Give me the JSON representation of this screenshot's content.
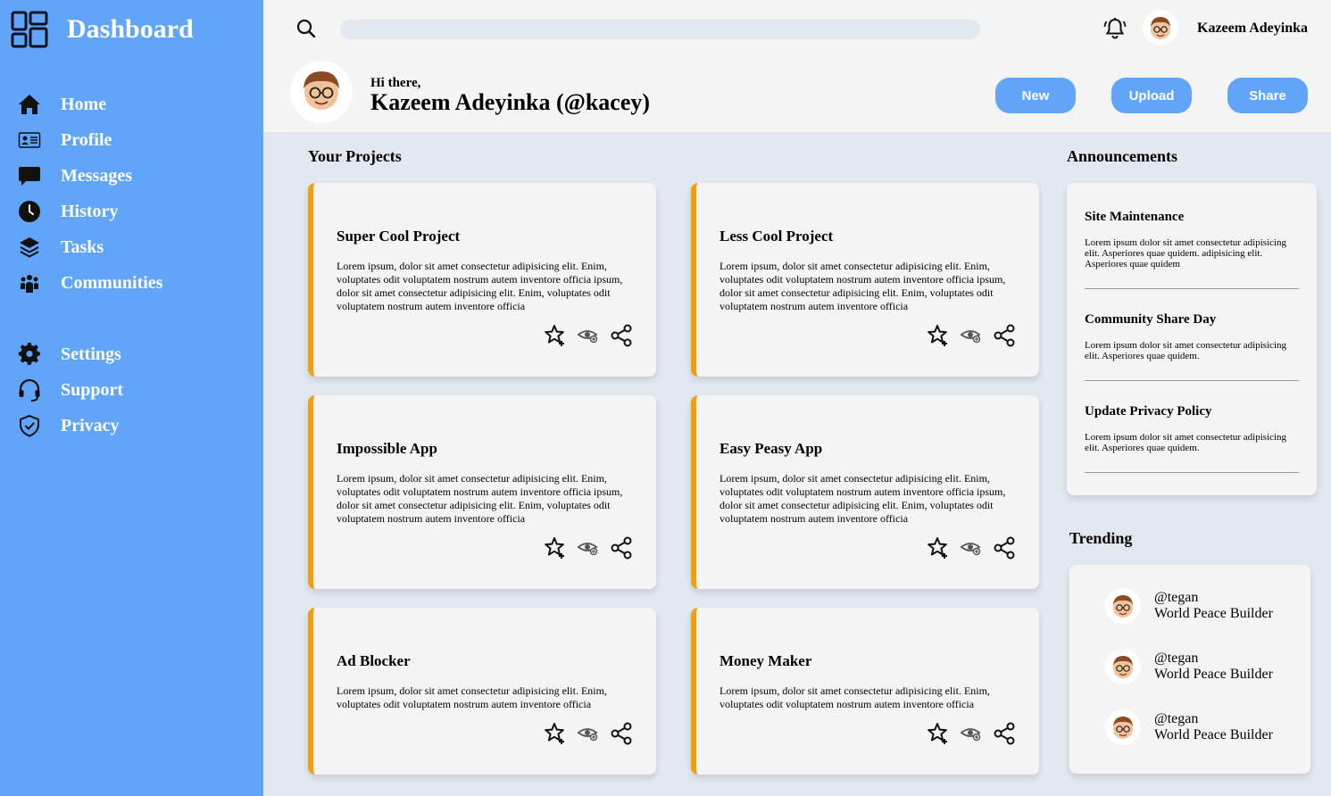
{
  "sidebar": {
    "title": "Dashboard",
    "nav": [
      {
        "label": "Home",
        "icon": "home-icon"
      },
      {
        "label": "Profile",
        "icon": "id-card-icon"
      },
      {
        "label": "Messages",
        "icon": "chat-icon"
      },
      {
        "label": "History",
        "icon": "clock-icon"
      },
      {
        "label": "Tasks",
        "icon": "layers-icon"
      },
      {
        "label": "Communities",
        "icon": "community-icon"
      }
    ],
    "nav2": [
      {
        "label": "Settings",
        "icon": "gear-icon"
      },
      {
        "label": "Support",
        "icon": "headset-icon"
      },
      {
        "label": "Privacy",
        "icon": "shield-icon"
      }
    ]
  },
  "header": {
    "search_placeholder": "",
    "username": "Kazeem Adeyinka",
    "greeting": "Hi there,",
    "fullname": "Kazeem Adeyinka (@kacey)",
    "buttons": {
      "new": "New",
      "upload": "Upload",
      "share": "Share"
    }
  },
  "projects": {
    "title": "Your Projects",
    "items": [
      {
        "title": "Super Cool Project",
        "body": "Lorem ipsum, dolor sit amet consectetur adipisicing elit. Enim, voluptates odit voluptatem nostrum autem inventore officia ipsum, dolor sit amet consectetur adipisicing elit. Enim, voluptates odit voluptatem nostrum autem inventore officia"
      },
      {
        "title": "Less Cool Project",
        "body": "Lorem ipsum, dolor sit amet consectetur adipisicing elit. Enim, voluptates odit voluptatem nostrum autem inventore officia ipsum, dolor sit amet consectetur adipisicing elit. Enim, voluptates odit voluptatem nostrum autem inventore officia"
      },
      {
        "title": "Impossible App",
        "body": "Lorem ipsum, dolor sit amet consectetur adipisicing elit. Enim, voluptates odit voluptatem nostrum autem inventore officia ipsum, dolor sit amet consectetur adipisicing elit. Enim, voluptates odit voluptatem nostrum autem inventore officia"
      },
      {
        "title": "Easy Peasy App",
        "body": "Lorem ipsum, dolor sit amet consectetur adipisicing elit. Enim, voluptates odit voluptatem nostrum autem inventore officia ipsum, dolor sit amet consectetur adipisicing elit. Enim, voluptates odit voluptatem nostrum autem inventore officia"
      },
      {
        "title": "Ad Blocker",
        "body": "Lorem ipsum, dolor sit amet consectetur adipisicing elit. Enim, voluptates odit voluptatem nostrum autem inventore officia"
      },
      {
        "title": "Money Maker",
        "body": "Lorem ipsum, dolor sit amet consectetur adipisicing elit. Enim, voluptates odit voluptatem nostrum autem inventore officia"
      }
    ],
    "action_icons": [
      "star-plus-icon",
      "eye-icon",
      "share-icon"
    ]
  },
  "announcements": {
    "title": "Announcements",
    "items": [
      {
        "title": "Site Maintenance",
        "text": "Lorem ipsum dolor sit amet consectetur adipisicing elit. Asperiores quae quidem. adipisicing elit. Asperiores quae quidem"
      },
      {
        "title": "Community Share Day",
        "text": "Lorem ipsum dolor sit amet consectetur adipisicing elit. Asperiores quae quidem."
      },
      {
        "title": "Update Privacy Policy",
        "text": "Lorem ipsum dolor sit amet consectetur adipisicing elit. Asperiores quae quidem."
      }
    ]
  },
  "trending": {
    "title": "Trending",
    "items": [
      {
        "handle": "@tegan",
        "role": "World Peace Builder"
      },
      {
        "handle": "@tegan",
        "role": "World Peace Builder"
      },
      {
        "handle": "@tegan",
        "role": "World Peace Builder"
      }
    ]
  },
  "colors": {
    "sidebar": "#60a5fa",
    "accent": "#f59e0b",
    "background": "#e2e8f0",
    "surface": "#f4f4f4"
  }
}
